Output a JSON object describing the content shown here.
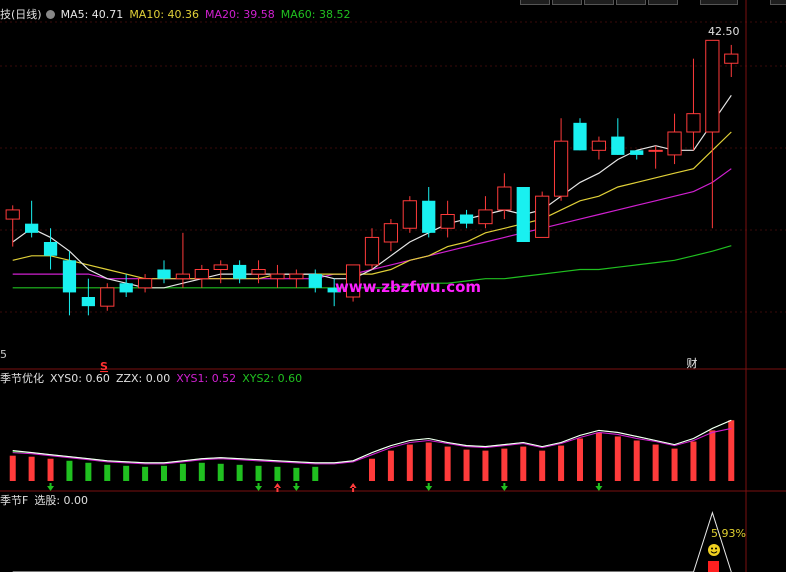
{
  "colors": {
    "bg": "#000000",
    "up": "#ff3b3b",
    "down": "#19f0f0",
    "grid": "#3a0a0a",
    "ma5": "#e6e6e6",
    "ma10": "#e0d038",
    "ma20": "#d020d0",
    "ma60": "#20c020",
    "xys0": "#ffffff",
    "zzx": "#ffffff",
    "xys1": "#d020d0",
    "xys2": "#20c020"
  },
  "main_panel": {
    "title": "技(日线)",
    "icon": "settings-dot-icon",
    "ma5_label": "MA5: 40.71",
    "ma10_label": "MA10: 40.36",
    "ma20_label": "MA20: 39.58",
    "ma60_label": "MA60: 38.52",
    "high_label": "42.50",
    "low_label": "5",
    "s_marker": "S",
    "cai_marker": "财",
    "watermark": "www.zbzfwu.com"
  },
  "sub1": {
    "title": "季节优化",
    "xys0": "XYS0: 0.60",
    "zzx": "ZZX: 0.00",
    "xys1": "XYS1: 0.52",
    "xys2": "XYS2: 0.60"
  },
  "sub2": {
    "title": "季节F",
    "xuangu": "选股: 0.00",
    "pct_label": "5.93",
    "pct_unit": "%",
    "smiley": "smiley-icon"
  },
  "chart_data": [
    {
      "type": "candlestick",
      "name": "main",
      "ylim": [
        36.2,
        43.4
      ],
      "candles": [
        {
          "o": 39.1,
          "h": 39.4,
          "l": 38.5,
          "c": 39.3
        },
        {
          "o": 39.0,
          "h": 39.5,
          "l": 38.7,
          "c": 38.8
        },
        {
          "o": 38.6,
          "h": 38.9,
          "l": 38.0,
          "c": 38.3
        },
        {
          "o": 38.2,
          "h": 38.4,
          "l": 37.0,
          "c": 37.5
        },
        {
          "o": 37.4,
          "h": 37.8,
          "l": 37.0,
          "c": 37.2
        },
        {
          "o": 37.2,
          "h": 37.7,
          "l": 37.1,
          "c": 37.6
        },
        {
          "o": 37.7,
          "h": 37.9,
          "l": 37.4,
          "c": 37.5
        },
        {
          "o": 37.6,
          "h": 37.9,
          "l": 37.5,
          "c": 37.8
        },
        {
          "o": 38.0,
          "h": 38.2,
          "l": 37.7,
          "c": 37.8
        },
        {
          "o": 37.8,
          "h": 38.8,
          "l": 37.6,
          "c": 37.9
        },
        {
          "o": 37.8,
          "h": 38.1,
          "l": 37.6,
          "c": 38.0
        },
        {
          "o": 38.0,
          "h": 38.2,
          "l": 37.7,
          "c": 38.1
        },
        {
          "o": 38.1,
          "h": 38.2,
          "l": 37.7,
          "c": 37.8
        },
        {
          "o": 37.9,
          "h": 38.2,
          "l": 37.7,
          "c": 38.0
        },
        {
          "o": 37.8,
          "h": 38.1,
          "l": 37.6,
          "c": 37.9
        },
        {
          "o": 37.8,
          "h": 38.0,
          "l": 37.6,
          "c": 37.9
        },
        {
          "o": 37.9,
          "h": 38.0,
          "l": 37.5,
          "c": 37.6
        },
        {
          "o": 37.6,
          "h": 37.8,
          "l": 37.2,
          "c": 37.5
        },
        {
          "o": 37.4,
          "h": 38.1,
          "l": 37.3,
          "c": 38.1
        },
        {
          "o": 38.1,
          "h": 38.9,
          "l": 38.0,
          "c": 38.7
        },
        {
          "o": 38.6,
          "h": 39.1,
          "l": 38.4,
          "c": 39.0
        },
        {
          "o": 38.9,
          "h": 39.6,
          "l": 38.8,
          "c": 39.5
        },
        {
          "o": 39.5,
          "h": 39.8,
          "l": 38.7,
          "c": 38.8
        },
        {
          "o": 38.9,
          "h": 39.5,
          "l": 38.7,
          "c": 39.2
        },
        {
          "o": 39.2,
          "h": 39.3,
          "l": 38.9,
          "c": 39.0
        },
        {
          "o": 39.0,
          "h": 39.6,
          "l": 38.9,
          "c": 39.3
        },
        {
          "o": 39.3,
          "h": 40.1,
          "l": 39.1,
          "c": 39.8
        },
        {
          "o": 39.8,
          "h": 39.8,
          "l": 38.6,
          "c": 38.6
        },
        {
          "o": 38.7,
          "h": 39.7,
          "l": 38.7,
          "c": 39.6
        },
        {
          "o": 39.6,
          "h": 41.3,
          "l": 39.5,
          "c": 40.8
        },
        {
          "o": 41.2,
          "h": 41.3,
          "l": 40.6,
          "c": 40.6
        },
        {
          "o": 40.6,
          "h": 40.9,
          "l": 40.4,
          "c": 40.8
        },
        {
          "o": 40.9,
          "h": 41.3,
          "l": 40.5,
          "c": 40.5
        },
        {
          "o": 40.6,
          "h": 40.6,
          "l": 40.4,
          "c": 40.5
        },
        {
          "o": 40.6,
          "h": 40.7,
          "l": 40.2,
          "c": 40.6
        },
        {
          "o": 40.5,
          "h": 41.4,
          "l": 40.3,
          "c": 41.0
        },
        {
          "o": 41.0,
          "h": 42.6,
          "l": 40.6,
          "c": 41.4
        },
        {
          "o": 41.0,
          "h": 43.0,
          "l": 38.9,
          "c": 43.0
        },
        {
          "o": 42.5,
          "h": 42.9,
          "l": 42.2,
          "c": 42.7
        }
      ],
      "ma5": [
        38.6,
        38.9,
        38.7,
        38.4,
        38.0,
        37.8,
        37.7,
        37.6,
        37.6,
        37.7,
        37.8,
        37.9,
        37.9,
        37.9,
        37.9,
        37.9,
        37.9,
        37.8,
        37.8,
        38.0,
        38.3,
        38.6,
        38.8,
        39.0,
        39.1,
        39.2,
        39.3,
        39.2,
        39.3,
        39.6,
        39.9,
        40.1,
        40.4,
        40.6,
        40.7,
        40.6,
        40.6,
        41.2,
        41.8
      ],
      "ma10": [
        38.2,
        38.3,
        38.3,
        38.2,
        38.1,
        38.0,
        37.9,
        37.8,
        37.8,
        37.8,
        37.8,
        37.8,
        37.8,
        37.8,
        37.9,
        37.9,
        37.9,
        37.9,
        37.9,
        37.9,
        38.0,
        38.2,
        38.3,
        38.5,
        38.6,
        38.8,
        38.9,
        39.0,
        39.1,
        39.3,
        39.5,
        39.6,
        39.8,
        39.9,
        40.0,
        40.1,
        40.2,
        40.6,
        41.0
      ],
      "ma20": [
        37.9,
        37.9,
        37.9,
        37.9,
        37.9,
        37.8,
        37.8,
        37.8,
        37.8,
        37.8,
        37.8,
        37.8,
        37.8,
        37.8,
        37.8,
        37.8,
        37.8,
        37.9,
        37.9,
        38.0,
        38.1,
        38.2,
        38.3,
        38.4,
        38.5,
        38.6,
        38.7,
        38.8,
        38.9,
        39.0,
        39.1,
        39.2,
        39.3,
        39.4,
        39.5,
        39.6,
        39.7,
        39.9,
        40.2
      ],
      "ma60": [
        37.6,
        37.6,
        37.6,
        37.6,
        37.6,
        37.6,
        37.6,
        37.6,
        37.6,
        37.6,
        37.6,
        37.6,
        37.6,
        37.6,
        37.6,
        37.6,
        37.6,
        37.6,
        37.6,
        37.6,
        37.6,
        37.65,
        37.7,
        37.7,
        37.75,
        37.8,
        37.8,
        37.85,
        37.9,
        37.95,
        38.0,
        38.0,
        38.05,
        38.1,
        38.15,
        38.2,
        38.3,
        38.4,
        38.52
      ]
    },
    {
      "type": "bar",
      "name": "季节优化",
      "ylim": [
        0,
        1
      ],
      "xys0": [
        0.3,
        0.28,
        0.26,
        0.24,
        0.22,
        0.2,
        0.19,
        0.18,
        0.18,
        0.2,
        0.22,
        0.23,
        0.22,
        0.21,
        0.2,
        0.19,
        0.18,
        0.18,
        0.2,
        0.28,
        0.35,
        0.4,
        0.42,
        0.38,
        0.35,
        0.34,
        0.36,
        0.38,
        0.34,
        0.38,
        0.45,
        0.5,
        0.48,
        0.44,
        0.4,
        0.36,
        0.42,
        0.52,
        0.6
      ],
      "xys1": [
        0.28,
        0.27,
        0.25,
        0.23,
        0.21,
        0.19,
        0.18,
        0.17,
        0.17,
        0.19,
        0.21,
        0.22,
        0.21,
        0.2,
        0.19,
        0.18,
        0.17,
        0.17,
        0.19,
        0.26,
        0.33,
        0.38,
        0.4,
        0.37,
        0.34,
        0.33,
        0.35,
        0.37,
        0.33,
        0.37,
        0.43,
        0.48,
        0.46,
        0.42,
        0.39,
        0.35,
        0.4,
        0.48,
        0.52
      ],
      "xys2": [
        0.29,
        0.28,
        0.26,
        0.24,
        0.22,
        0.2,
        0.19,
        0.18,
        0.18,
        0.2,
        0.22,
        0.23,
        0.22,
        0.21,
        0.2,
        0.19,
        0.18,
        0.18,
        0.2,
        0.28,
        0.35,
        0.4,
        0.42,
        0.38,
        0.35,
        0.34,
        0.36,
        0.38,
        0.34,
        0.38,
        0.45,
        0.5,
        0.48,
        0.44,
        0.4,
        0.36,
        0.42,
        0.52,
        0.6
      ],
      "bars": [
        0.25,
        0.24,
        0.22,
        0.0,
        0.0,
        0.0,
        0.0,
        0.0,
        0.0,
        0.0,
        0.0,
        0.0,
        0.0,
        0.0,
        0.0,
        0.0,
        0.0,
        0.0,
        0.0,
        0.22,
        0.3,
        0.36,
        0.38,
        0.34,
        0.31,
        0.3,
        0.32,
        0.34,
        0.3,
        0.35,
        0.42,
        0.48,
        0.44,
        0.4,
        0.36,
        0.32,
        0.39,
        0.5,
        0.6
      ],
      "green_bars": [
        0,
        0,
        0,
        0.2,
        0.18,
        0.16,
        0.15,
        0.14,
        0.15,
        0.17,
        0.18,
        0.17,
        0.16,
        0.15,
        0.14,
        0.13,
        0.14,
        0.0,
        0,
        0,
        0,
        0,
        0,
        0,
        0,
        0,
        0,
        0,
        0,
        0,
        0,
        0,
        0,
        0,
        0,
        0,
        0,
        0,
        0
      ],
      "down_arrows": [
        2,
        13,
        15,
        22,
        26,
        31
      ],
      "up_arrows": [
        14,
        18
      ]
    },
    {
      "type": "line",
      "name": "季节F",
      "ylim": [
        0,
        6
      ],
      "values": [
        0,
        0,
        0,
        0,
        0,
        0,
        0,
        0,
        0,
        0,
        0,
        0,
        0,
        0,
        0,
        0,
        0,
        0,
        0,
        0,
        0,
        0,
        0,
        0,
        0,
        0,
        0,
        0,
        0,
        0,
        0,
        0,
        0,
        0,
        0,
        0,
        0,
        5.93,
        0
      ]
    }
  ]
}
